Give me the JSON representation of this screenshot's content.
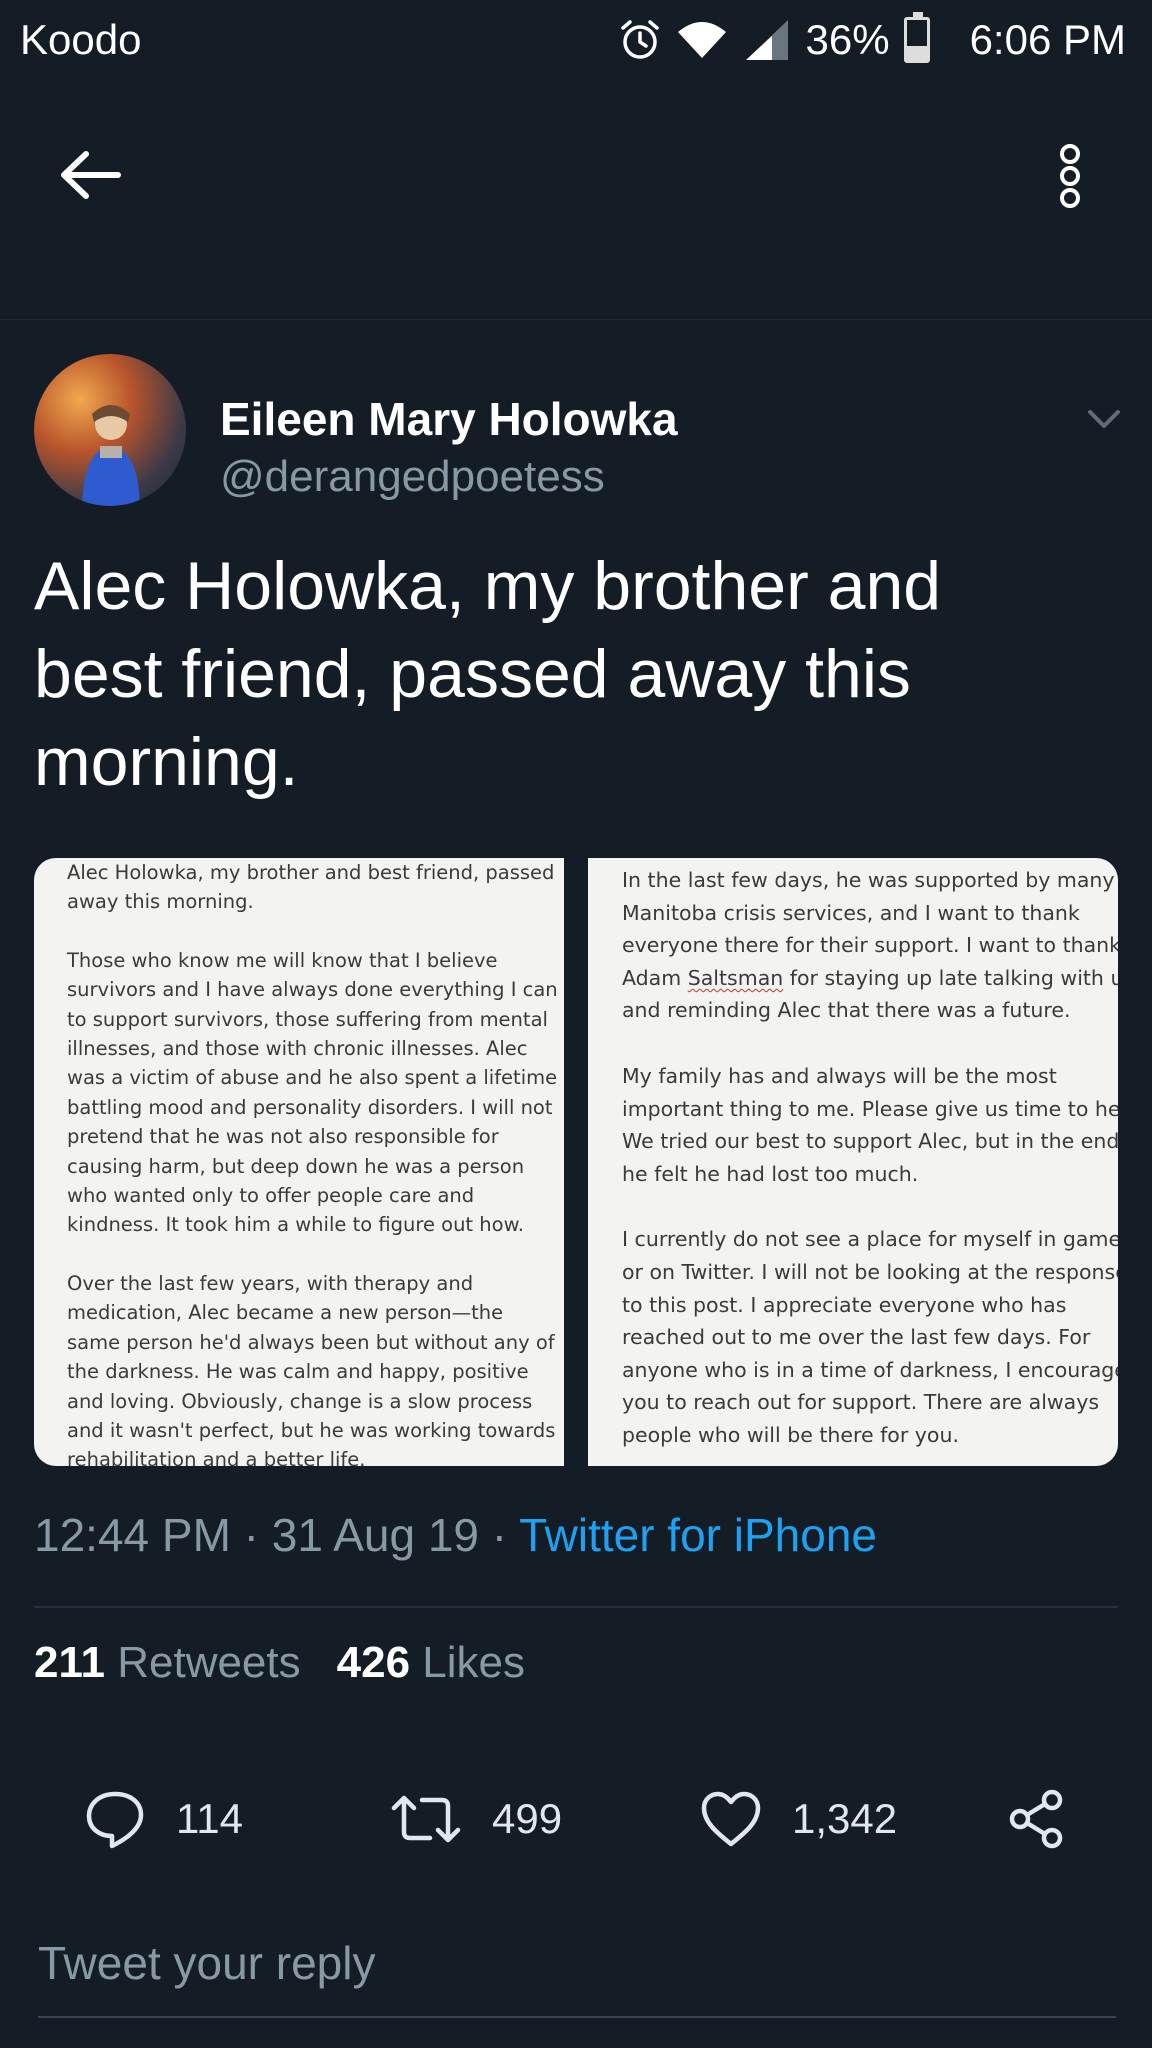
{
  "status_bar": {
    "carrier": "Koodo",
    "battery": "36%",
    "battery_level": 0.36,
    "time": "6:06 PM",
    "icons": [
      "alarm-icon",
      "wifi-icon",
      "signal-icon",
      "battery-icon"
    ]
  },
  "app_bar": {
    "back_icon": "arrow-left-icon",
    "more_icon": "more-vertical-icon"
  },
  "tweet": {
    "author": {
      "display_name": "Eileen Mary Holowka",
      "handle": "@derangedpoetess"
    },
    "text_lines": [
      "Alec Holowka, my brother and",
      "best friend, passed away this",
      "morning."
    ],
    "media": {
      "left_page": {
        "paragraphs": [
          [
            "Alec Holowka, my brother and best friend, passed",
            "away this morning."
          ],
          [
            "Those who know me will know that I believe",
            "survivors and I have always done everything I can",
            "to support survivors, those suffering from mental",
            "illnesses, and those with chronic illnesses. Alec",
            "was a victim of abuse and he also spent a lifetime",
            "battling mood and personality disorders. I will not",
            "pretend that he was not also responsible for",
            "causing harm, but deep down he was a person",
            "who wanted only to offer people care and",
            "kindness. It took him a while to figure out how."
          ],
          [
            "Over the last few years, with therapy and",
            "medication, Alec became a new person—the",
            "same person he'd always been but without any of",
            "the darkness. He was calm and happy, positive",
            "and loving. Obviously, change is a slow process",
            "and it wasn't perfect, but he was working towards",
            "rehabilitation and a better life."
          ]
        ]
      },
      "right_page": {
        "paragraphs": [
          [
            "In the last few days, he was supported by many",
            "Manitoba crisis services, and I want to thank",
            "everyone there for their support. I want to thank"
          ],
          [
            "My family has and always will be the most",
            "important thing to me. Please give us time to hea",
            "We tried our best to support Alec, but in the end",
            "he felt he had lost too much."
          ],
          [
            "I currently do not see a place for myself in game",
            "or on Twitter. I will not be looking at the response",
            "to this post. I appreciate everyone who has",
            "reached out to me over the last few days. For",
            "anyone who is in a time of darkness, I encourage",
            "you to reach out for support. There are always",
            "people who will be there for you."
          ]
        ],
        "line4_before": "Adam ",
        "line4_squiggle": "Saltsman",
        "line4_after": " for staying up late talking with u",
        "line5": "and reminding Alec that there was a future."
      }
    },
    "time": "12:44 PM",
    "date": "31 Aug 19",
    "separator": " · ",
    "source": "Twitter for iPhone",
    "retweets_count": "211",
    "retweets_label": "Retweets",
    "likes_count": "426",
    "likes_label": "Likes"
  },
  "actions": {
    "reply_count": "114",
    "retweet_count": "499",
    "like_count": "1,342"
  },
  "reply_box": {
    "placeholder": "Tweet your reply"
  },
  "colors": {
    "background": "#141d26",
    "link": "#1da1f2",
    "secondary_text": "#8899a6"
  }
}
